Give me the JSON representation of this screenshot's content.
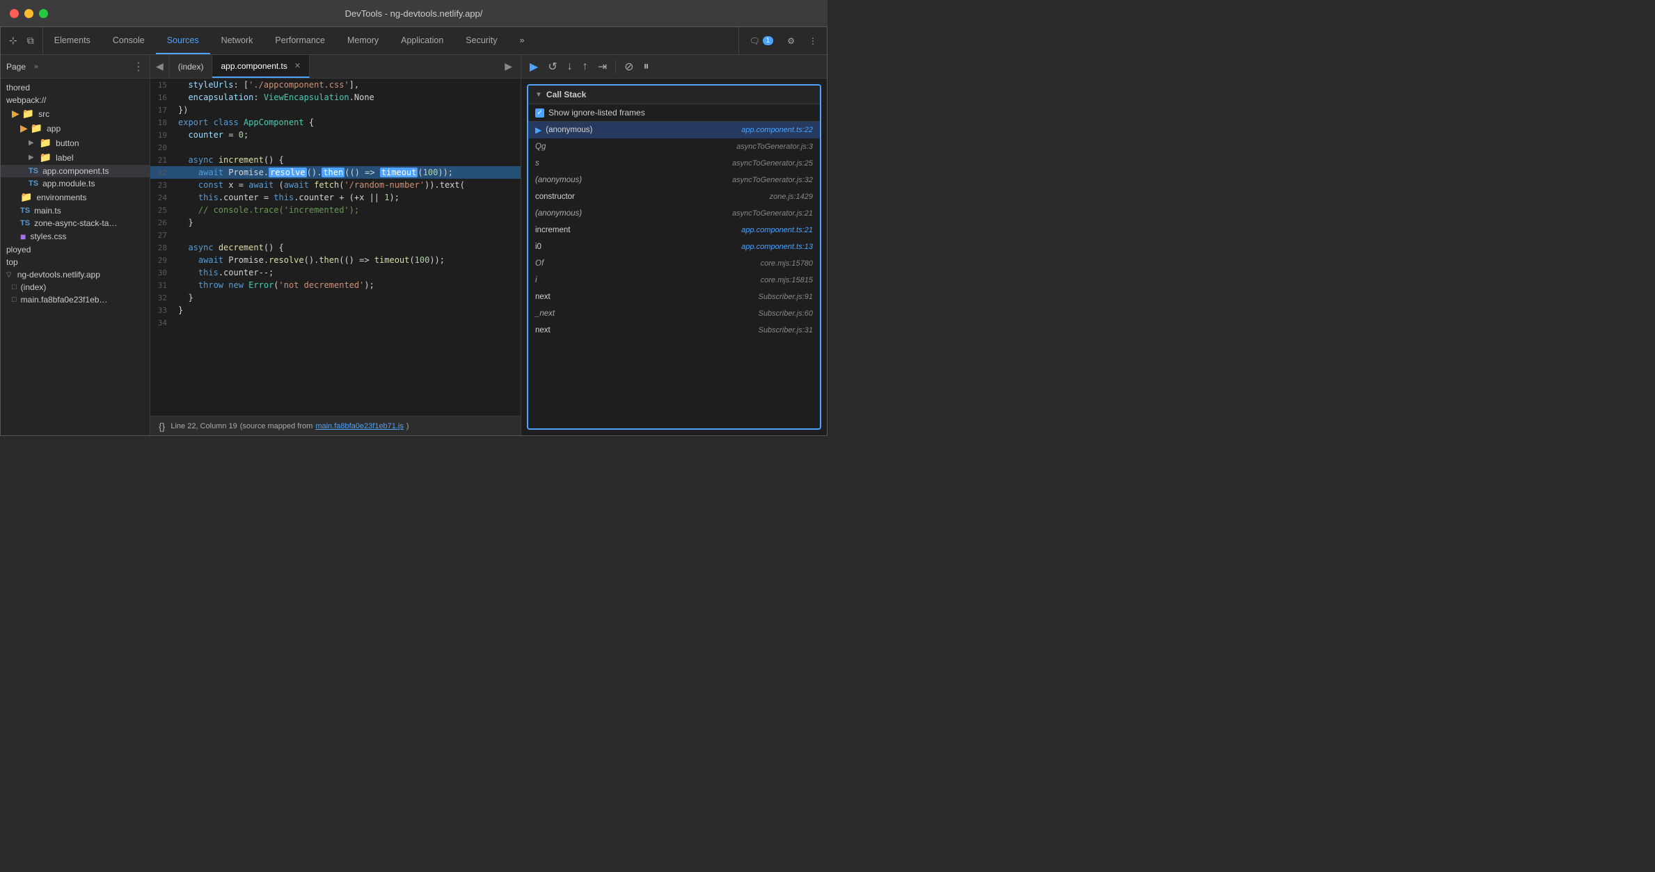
{
  "titlebar": {
    "title": "DevTools - ng-devtools.netlify.app/"
  },
  "nav": {
    "tabs": [
      {
        "id": "elements",
        "label": "Elements",
        "active": false
      },
      {
        "id": "console",
        "label": "Console",
        "active": false
      },
      {
        "id": "sources",
        "label": "Sources",
        "active": true
      },
      {
        "id": "network",
        "label": "Network",
        "active": false
      },
      {
        "id": "performance",
        "label": "Performance",
        "active": false
      },
      {
        "id": "memory",
        "label": "Memory",
        "active": false
      },
      {
        "id": "application",
        "label": "Application",
        "active": false
      },
      {
        "id": "security",
        "label": "Security",
        "active": false
      }
    ],
    "more_tabs_label": "»",
    "notification_count": "1",
    "settings_label": "⚙",
    "more_label": "⋮"
  },
  "sidebar": {
    "header_label": "Page",
    "more_label": "»",
    "items": [
      {
        "id": "thored",
        "label": "thored",
        "type": "text",
        "indent": 0
      },
      {
        "id": "webpack",
        "label": "webpack://",
        "type": "text",
        "indent": 0
      },
      {
        "id": "src",
        "label": "src",
        "type": "folder-orange",
        "indent": 1
      },
      {
        "id": "app",
        "label": "app",
        "type": "folder-orange",
        "indent": 2
      },
      {
        "id": "button",
        "label": "button",
        "type": "folder-orange",
        "indent": 3
      },
      {
        "id": "label",
        "label": "label",
        "type": "folder-orange",
        "indent": 3
      },
      {
        "id": "app-component-ts",
        "label": "app.component.ts",
        "type": "file-ts",
        "indent": 3,
        "selected": true
      },
      {
        "id": "app-module-ts",
        "label": "app.module.ts",
        "type": "file-ts",
        "indent": 3
      },
      {
        "id": "environments",
        "label": "environments",
        "type": "folder-orange",
        "indent": 2
      },
      {
        "id": "main-ts",
        "label": "main.ts",
        "type": "file-ts",
        "indent": 2
      },
      {
        "id": "zone-async",
        "label": "zone-async-stack-ta…",
        "type": "file-ts",
        "indent": 2
      },
      {
        "id": "styles-css",
        "label": "styles.css",
        "type": "file-css",
        "indent": 2
      },
      {
        "id": "ployed",
        "label": "ployed",
        "type": "text",
        "indent": 0
      },
      {
        "id": "top",
        "label": "top",
        "type": "text",
        "indent": 0
      },
      {
        "id": "ng-devtools",
        "label": "ng-devtools.netlify.app",
        "type": "domain",
        "indent": 0
      },
      {
        "id": "index",
        "label": "(index)",
        "type": "file-gray",
        "indent": 1
      },
      {
        "id": "main-fa8b",
        "label": "main.fa8bfa0e23f1eb…",
        "type": "file-gray",
        "indent": 1
      }
    ]
  },
  "editor": {
    "tabs": [
      {
        "id": "index",
        "label": "(index)",
        "closeable": false
      },
      {
        "id": "app-component",
        "label": "app.component.ts",
        "closeable": true,
        "active": true
      }
    ],
    "lines": [
      {
        "num": 15,
        "content": "  styleUrls: ['./appcomponent.css'],"
      },
      {
        "num": 16,
        "content": "  encapsulation: ViewEncapsulation.None"
      },
      {
        "num": 17,
        "content": "})"
      },
      {
        "num": 18,
        "content": "export class AppComponent {"
      },
      {
        "num": 19,
        "content": "  counter = 0;"
      },
      {
        "num": 20,
        "content": ""
      },
      {
        "num": 21,
        "content": "  async increment() {"
      },
      {
        "num": 22,
        "content": "    await Promise.resolve().then(() => timeout(100));",
        "highlighted": true,
        "breakpoint": true
      },
      {
        "num": 23,
        "content": "    const x = await (await fetch('/random-number')).text("
      },
      {
        "num": 24,
        "content": "    this.counter = this.counter + (+x || 1);"
      },
      {
        "num": 25,
        "content": "    // console.trace('incremented');"
      },
      {
        "num": 26,
        "content": "  }"
      },
      {
        "num": 27,
        "content": ""
      },
      {
        "num": 28,
        "content": "  async decrement() {"
      },
      {
        "num": 29,
        "content": "    await Promise.resolve().then(() => timeout(100));"
      },
      {
        "num": 30,
        "content": "    this.counter--;"
      },
      {
        "num": 31,
        "content": "    throw new Error('not decremented');"
      },
      {
        "num": 32,
        "content": "  }"
      },
      {
        "num": 33,
        "content": "}"
      },
      {
        "num": 34,
        "content": ""
      }
    ],
    "status": {
      "line": "Line 22, Column 19",
      "source_map": "(source mapped from main.fa8bfa0e23f1eb71.js)"
    }
  },
  "call_stack": {
    "title": "Call Stack",
    "show_ignore_frames": "Show ignore-listed frames",
    "entries": [
      {
        "fn": "(anonymous)",
        "location": "app.component.ts:22",
        "active": true,
        "italic": false,
        "show_arrow": true,
        "location_blue": true
      },
      {
        "fn": "Qg",
        "location": "asyncToGenerator.js:3",
        "italic": true
      },
      {
        "fn": "s",
        "location": "asyncToGenerator.js:25",
        "italic": true
      },
      {
        "fn": "(anonymous)",
        "location": "asyncToGenerator.js:32",
        "italic": true
      },
      {
        "fn": "constructor",
        "location": "zone.js:1429",
        "italic": false
      },
      {
        "fn": "(anonymous)",
        "location": "asyncToGenerator.js:21",
        "italic": true
      },
      {
        "fn": "increment",
        "location": "app.component.ts:21",
        "italic": false,
        "location_blue": true
      },
      {
        "fn": "i0",
        "location": "app.component.ts:13",
        "italic": false,
        "location_blue": true
      },
      {
        "fn": "Of",
        "location": "core.mjs:15780",
        "italic": true
      },
      {
        "fn": "i",
        "location": "core.mjs:15815",
        "italic": true
      },
      {
        "fn": "next",
        "location": "Subscriber.js:91",
        "italic": false
      },
      {
        "fn": "_next",
        "location": "Subscriber.js:60",
        "italic": true
      },
      {
        "fn": "next",
        "location": "Subscriber.js:31",
        "italic": false
      }
    ]
  },
  "debugger_toolbar": {
    "btns": [
      {
        "id": "resume",
        "symbol": "▶",
        "label": "Resume",
        "active": true
      },
      {
        "id": "step-over",
        "symbol": "↺",
        "label": "Step over"
      },
      {
        "id": "step-into",
        "symbol": "↓",
        "label": "Step into"
      },
      {
        "id": "step-out",
        "symbol": "↑",
        "label": "Step out"
      },
      {
        "id": "step",
        "symbol": "⇥",
        "label": "Step"
      },
      {
        "id": "deactivate",
        "symbol": "⊘",
        "label": "Deactivate breakpoints"
      },
      {
        "id": "pause-exceptions",
        "symbol": "⏸",
        "label": "Pause on exceptions"
      }
    ]
  }
}
